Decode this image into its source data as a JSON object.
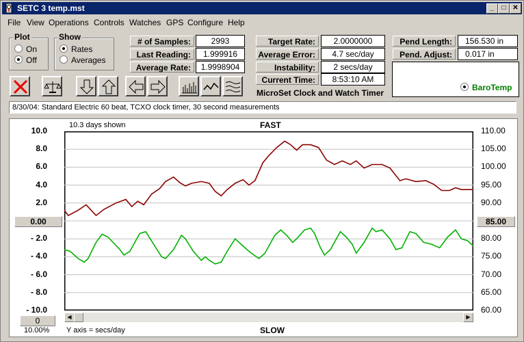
{
  "window": {
    "title": "SETC 3 temp.mst",
    "minimize": "_",
    "maximize": "□",
    "close": "✕"
  },
  "menu": [
    "File",
    "View",
    "Operations",
    "Controls",
    "Watches",
    "GPS",
    "Configure",
    "Help"
  ],
  "plot_group": {
    "title": "Plot",
    "options": [
      {
        "label": "On",
        "selected": false
      },
      {
        "label": "Off",
        "selected": true
      }
    ]
  },
  "show_group": {
    "title": "Show",
    "options": [
      {
        "label": "Rates",
        "selected": true
      },
      {
        "label": "Averages",
        "selected": false
      }
    ]
  },
  "stats": {
    "samples_label": "# of Samples:",
    "samples_value": "2993",
    "last_label": "Last Reading:",
    "last_value": "1.999916",
    "avg_label": "Average Rate:",
    "avg_value": "1.9998904"
  },
  "targets": {
    "target_label": "Target Rate:",
    "target_value": "2.0000000",
    "err_label": "Average Error:",
    "err_value": "4.7 sec/day",
    "instab_label": "Instability:",
    "instab_value": "2 secs/day",
    "time_label": "Current Time:",
    "time_value": "8:53:10 AM"
  },
  "pendulum": {
    "length_label": "Pend Length:",
    "length_value": "156.530 in",
    "adjust_label": "Pend. Adjust:",
    "adjust_value": "0.017 in",
    "sensor_label": "BaroTemp"
  },
  "app_subtitle": "MicroSet Clock and Watch Timer",
  "description": "8/30/04: Standard Electric 60 beat, TCXO clock timer, 30 second measurements",
  "chart": {
    "days_shown": "10.3 days shown",
    "fast_label": "FAST",
    "slow_label": "SLOW",
    "y_axis_note": "Y axis = secs/day",
    "left_center": "0.00",
    "right_center": "85.00",
    "bottom_left_value": "0",
    "zoom": "10.00%",
    "left_ticks": [
      "10.0",
      "8.0",
      "6.0",
      "4.0",
      "2.0",
      "- 2.0",
      "- 4.0",
      "- 6.0",
      "- 8.0",
      "- 10.0"
    ],
    "right_ticks": [
      "110.00",
      "105.00",
      "100.00",
      "95.00",
      "90.00",
      "80.00",
      "75.00",
      "70.00",
      "65.00",
      "60.00"
    ],
    "colors": {
      "rate": "#8b0000",
      "temp": "#00b000",
      "grid": "#c0c0c0"
    }
  },
  "chart_data": {
    "type": "line",
    "xlabel": "",
    "ylabel": "Y axis = secs/day",
    "ylim_left": [
      -10,
      10
    ],
    "ylim_right": [
      60,
      110
    ],
    "x_range_days": [
      0,
      10.3
    ],
    "series": [
      {
        "axis": "left",
        "points": [
          [
            0,
            1.2
          ],
          [
            0.1,
            0.6
          ],
          [
            0.35,
            1.2
          ],
          [
            0.55,
            1.8
          ],
          [
            0.8,
            0.6
          ],
          [
            1.0,
            1.3
          ],
          [
            1.3,
            2.0
          ],
          [
            1.55,
            2.4
          ],
          [
            1.7,
            1.6
          ],
          [
            1.85,
            2.2
          ],
          [
            2.0,
            1.8
          ],
          [
            2.2,
            3.0
          ],
          [
            2.4,
            3.6
          ],
          [
            2.55,
            4.4
          ],
          [
            2.75,
            4.9
          ],
          [
            2.9,
            4.3
          ],
          [
            3.05,
            3.9
          ],
          [
            3.2,
            4.2
          ],
          [
            3.45,
            4.4
          ],
          [
            3.65,
            4.2
          ],
          [
            3.8,
            3.3
          ],
          [
            3.95,
            2.8
          ],
          [
            4.1,
            3.5
          ],
          [
            4.3,
            4.2
          ],
          [
            4.5,
            4.6
          ],
          [
            4.65,
            4.0
          ],
          [
            4.8,
            4.5
          ],
          [
            5.0,
            6.5
          ],
          [
            5.15,
            7.3
          ],
          [
            5.35,
            8.2
          ],
          [
            5.55,
            8.9
          ],
          [
            5.7,
            8.5
          ],
          [
            5.85,
            7.9
          ],
          [
            6.0,
            8.5
          ],
          [
            6.2,
            8.5
          ],
          [
            6.4,
            8.2
          ],
          [
            6.6,
            6.8
          ],
          [
            6.8,
            6.3
          ],
          [
            7.0,
            6.7
          ],
          [
            7.2,
            6.3
          ],
          [
            7.35,
            6.7
          ],
          [
            7.55,
            5.9
          ],
          [
            7.75,
            6.3
          ],
          [
            8.0,
            6.3
          ],
          [
            8.2,
            5.9
          ],
          [
            8.45,
            4.5
          ],
          [
            8.6,
            4.7
          ],
          [
            8.85,
            4.4
          ],
          [
            9.1,
            4.5
          ],
          [
            9.3,
            4.1
          ],
          [
            9.5,
            3.4
          ],
          [
            9.7,
            3.4
          ],
          [
            9.85,
            3.7
          ],
          [
            10.0,
            3.5
          ],
          [
            10.3,
            3.5
          ]
        ]
      },
      {
        "axis": "right",
        "points": [
          [
            0,
            77
          ],
          [
            0.15,
            76.5
          ],
          [
            0.35,
            74.5
          ],
          [
            0.5,
            73.5
          ],
          [
            0.6,
            74.5
          ],
          [
            0.8,
            79
          ],
          [
            0.95,
            81.3
          ],
          [
            1.1,
            80.5
          ],
          [
            1.4,
            77
          ],
          [
            1.5,
            75.5
          ],
          [
            1.65,
            76.5
          ],
          [
            1.9,
            81.5
          ],
          [
            2.05,
            82
          ],
          [
            2.25,
            78.5
          ],
          [
            2.45,
            75
          ],
          [
            2.55,
            74.5
          ],
          [
            2.75,
            77
          ],
          [
            2.95,
            81
          ],
          [
            3.05,
            80
          ],
          [
            3.25,
            76.5
          ],
          [
            3.45,
            74
          ],
          [
            3.55,
            75
          ],
          [
            3.65,
            74
          ],
          [
            3.8,
            73
          ],
          [
            3.95,
            73.5
          ],
          [
            4.1,
            76.5
          ],
          [
            4.3,
            80
          ],
          [
            4.45,
            78.5
          ],
          [
            4.65,
            76.5
          ],
          [
            4.9,
            74.5
          ],
          [
            5.05,
            76
          ],
          [
            5.3,
            81
          ],
          [
            5.45,
            82.5
          ],
          [
            5.6,
            81
          ],
          [
            5.75,
            79
          ],
          [
            5.85,
            80
          ],
          [
            6.05,
            82.5
          ],
          [
            6.2,
            83
          ],
          [
            6.3,
            81.5
          ],
          [
            6.45,
            77.5
          ],
          [
            6.55,
            75.5
          ],
          [
            6.7,
            77
          ],
          [
            6.95,
            82
          ],
          [
            7.1,
            80.5
          ],
          [
            7.25,
            78.5
          ],
          [
            7.35,
            76
          ],
          [
            7.55,
            79
          ],
          [
            7.75,
            83
          ],
          [
            7.85,
            82
          ],
          [
            8.0,
            82.5
          ],
          [
            8.2,
            80
          ],
          [
            8.35,
            77
          ],
          [
            8.5,
            77.5
          ],
          [
            8.7,
            82
          ],
          [
            8.85,
            81.5
          ],
          [
            9.05,
            79
          ],
          [
            9.25,
            78.5
          ],
          [
            9.45,
            77.5
          ],
          [
            9.65,
            80.5
          ],
          [
            9.85,
            82.5
          ],
          [
            10.0,
            80
          ],
          [
            10.15,
            79.5
          ],
          [
            10.3,
            78
          ]
        ]
      }
    ]
  }
}
